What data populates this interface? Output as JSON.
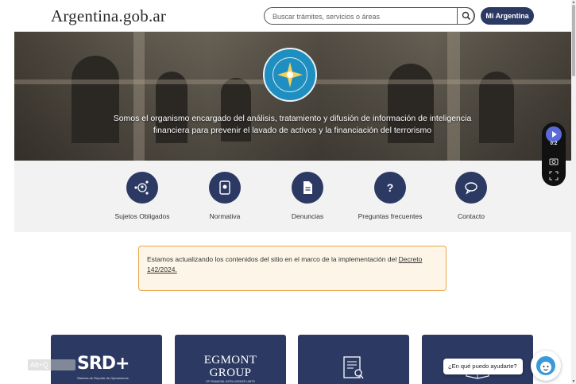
{
  "header": {
    "brand": "Argentina.gob.ar",
    "search_placeholder": "Buscar trámites, servicios o áreas",
    "search_icon": "search-icon",
    "account_button": "Mi Argentina"
  },
  "hero": {
    "seal_icon": "uif-seal-logo",
    "text": "Somos el organismo encargado del análisis, tratamiento y difusión de información de inteligencia financiera para prevenir el lavado de activos y la financiación del terrorismo"
  },
  "quick_links": [
    {
      "label": "Sujetos Obligados",
      "icon": "people-network-icon"
    },
    {
      "label": "Normativa",
      "icon": "document-icon"
    },
    {
      "label": "Denuncias",
      "icon": "file-icon"
    },
    {
      "label": "Preguntas frecuentes",
      "icon": "question-icon"
    },
    {
      "label": "Contacto",
      "icon": "chat-icon"
    }
  ],
  "notice": {
    "text": "Estamos actualizando los contenidos del sitio en el marco de la implementación del ",
    "link": "Decreto 142/2024."
  },
  "cards": [
    {
      "title": "SRD+",
      "subtitle": "Sistema de Reporte de Operaciones"
    },
    {
      "title_line1": "EGMONT",
      "title_line2": "GROUP",
      "subtitle": "OF FINANCIAL INTELLIGENCE UNITS"
    },
    {
      "icon": "book-search-icon"
    },
    {
      "icon": "book-icon"
    }
  ],
  "media_widget": {
    "time": "0:2",
    "icons": [
      "play-icon",
      "camera-icon",
      "screenshot-icon"
    ]
  },
  "accessibility": {
    "shortcut": "Alt+Q"
  },
  "chat": {
    "prompt": "¿En qué puedo ayudarte?"
  },
  "colors": {
    "navy": "#2c3a63",
    "notice_border": "#e8a64a",
    "notice_bg": "#fdf6e8"
  }
}
